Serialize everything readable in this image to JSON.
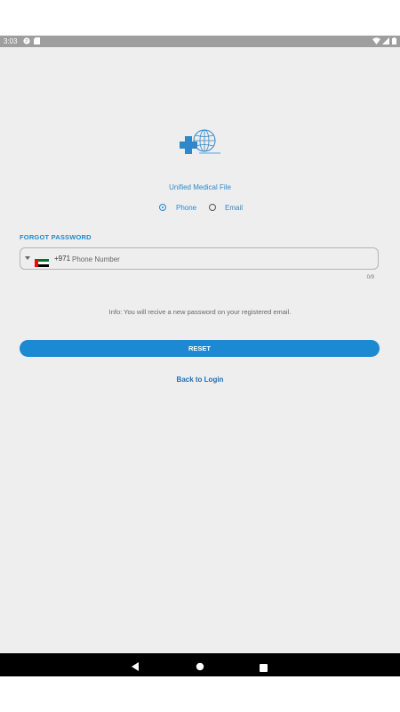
{
  "status_bar": {
    "time": "3:03"
  },
  "app": {
    "title": "Unified Medical File"
  },
  "login_type": {
    "options": [
      {
        "label": "Phone",
        "selected": true
      },
      {
        "label": "Email",
        "selected": false
      }
    ]
  },
  "form": {
    "section_label": "FORGOT PASSWORD",
    "country_code": "+971",
    "phone_placeholder": "Phone Number",
    "phone_value": "",
    "char_counter": "0/9"
  },
  "info_text": "Info: You will recive a new password on your registered email.",
  "actions": {
    "reset_label": "RESET",
    "back_to_login_label": "Back to Login"
  },
  "colors": {
    "accent": "#1b8ad3",
    "link": "#1f6db0",
    "background": "#eeeeee"
  }
}
